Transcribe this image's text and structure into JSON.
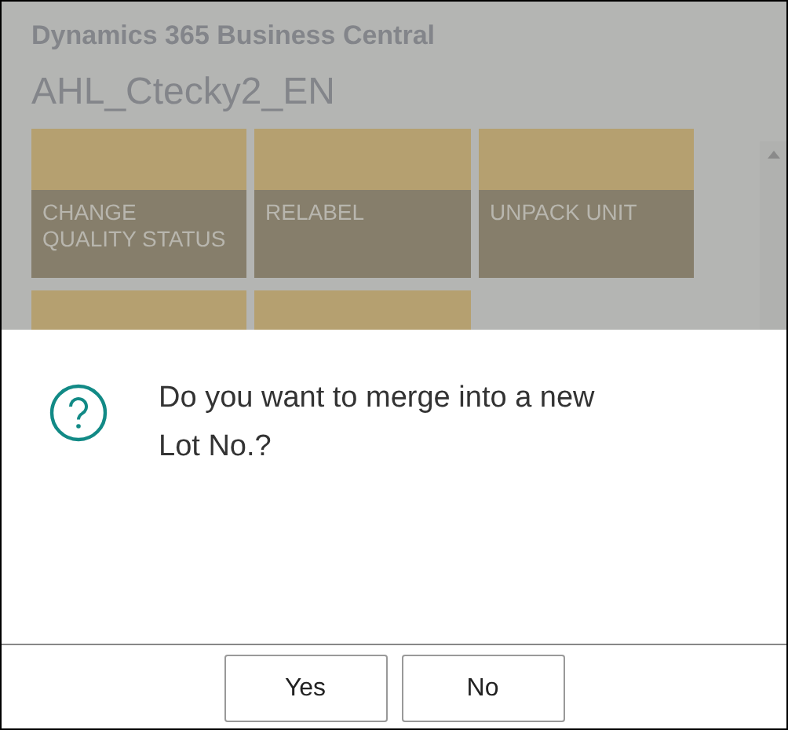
{
  "app": {
    "title": "Dynamics 365 Business Central",
    "subtitle": "AHL_Ctecky2_EN"
  },
  "tiles": [
    {
      "kind": "labeled",
      "label": "CHANGE QUALITY STATUS"
    },
    {
      "kind": "labeled",
      "label": "RELABEL"
    },
    {
      "kind": "labeled",
      "label": "UNPACK UNIT"
    },
    {
      "kind": "covered"
    },
    {
      "kind": "covered"
    }
  ],
  "dialog": {
    "message": "Do you want to merge into a new Lot No.?",
    "buttons": [
      "Yes",
      "No"
    ]
  }
}
